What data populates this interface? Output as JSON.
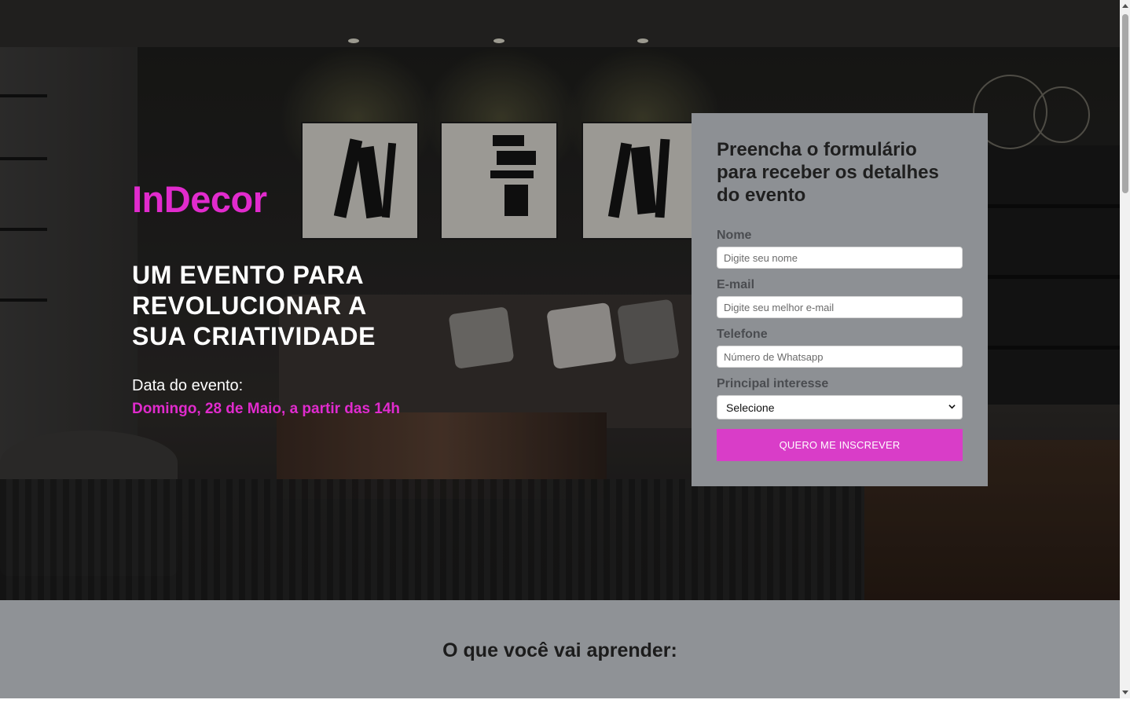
{
  "hero": {
    "brand": "InDecor",
    "headline": "UM EVENTO PARA REVOLUCIONAR A SUA CRIATIVIDADE",
    "date_label": "Data do evento:",
    "date_value": "Domingo, 28 de Maio, a partir das 14h"
  },
  "form": {
    "title": "Preencha o formulário para receber os detalhes do evento",
    "name_label": "Nome",
    "name_placeholder": "Digite seu nome",
    "email_label": "E-mail",
    "email_placeholder": "Digite seu melhor e-mail",
    "phone_label": "Telefone",
    "phone_placeholder": "Número de Whatsapp",
    "interest_label": "Principal interesse",
    "interest_selected": "Selecione",
    "submit_label": "QUERO ME INSCREVER"
  },
  "learn": {
    "title": "O que você vai aprender:"
  },
  "colors": {
    "accent": "#e12bcd",
    "button": "#d93dc8",
    "form_bg": "#8d9094",
    "section_bg": "#8f9296"
  },
  "icons": {
    "select_arrow": "chevron-down-icon"
  }
}
